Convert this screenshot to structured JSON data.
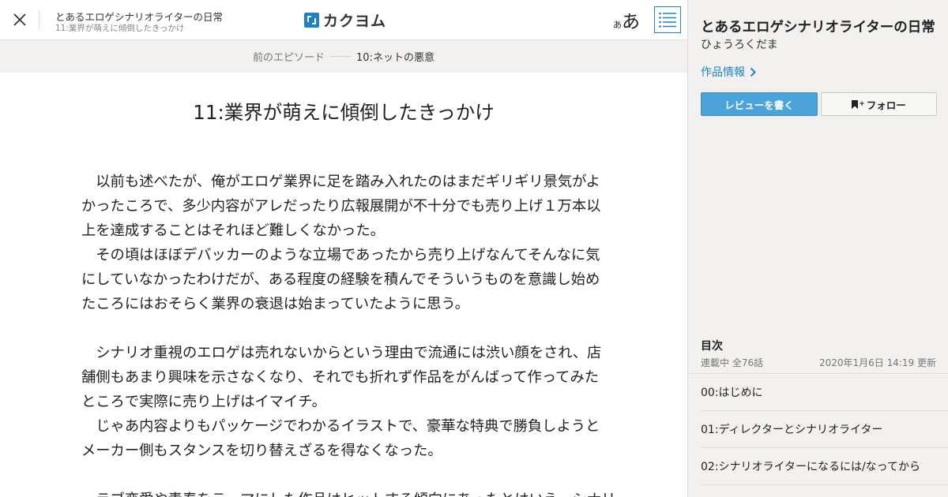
{
  "header": {
    "work_title": "とあるエロゲシナリオライターの日常",
    "episode_title": "11:業界が萌えに傾倒したきっかけ",
    "logo_text": "カクヨム",
    "font_small": "あ",
    "font_large": "あ",
    "icons": {
      "close": "close-icon",
      "logo": "kakuyomu-logo-icon",
      "toc": "list-icon"
    },
    "accent_color": "#1d82c4"
  },
  "episode_nav": {
    "prev_label": "前のエピソード",
    "prev_title": "10:ネットの悪意"
  },
  "episode": {
    "title": "11:業界が萌えに傾倒したきっかけ",
    "lines": [
      "　以前も述べたが、俺がエロゲ業界に足を踏み入れたのはまだギリギリ景気がよ",
      "かったころで、多少内容がアレだったり広報展開が不十分でも売り上げ１万本以",
      "上を達成することはそれほど難しくなかった。",
      "　その頃はほぼデバッカーのような立場であったから売り上げなんてそんなに気",
      "にしていなかったわけだが、ある程度の経験を積んでそういうものを意識し始め",
      "たころにはおそらく業界の衰退は始まっていたように思う。",
      "",
      "　シナリオ重視のエロゲは売れないからという理由で流通には渋い顔をされ、店",
      "舗側もあまり興味を示さなくなり、それでも折れず作品をがんばって作ってみた",
      "ところで実際に売り上げはイマイチ。",
      "　じゃあ内容よりもパッケージでわかるイラストで、豪華な特典で勝負しようと",
      "メーカー側もスタンスを切り替えざるを得なくなった。",
      "",
      "　ラブ恋愛や青春をテーマにした作品はヒットする傾向にあったとはいえ、シナリ"
    ]
  },
  "sidebar": {
    "work_title": "とあるエロゲシナリオライターの日常",
    "author": "ひょうろくだま",
    "info_link": "作品情報",
    "review_button": "レビューを書く",
    "follow_button": "フォロー",
    "icons": {
      "info_chevron": "chevron-right-icon",
      "follow": "bookmark-icon"
    },
    "review_button_color": "#4ba3d9"
  },
  "toc": {
    "heading": "目次",
    "status": "連載中 全76話",
    "updated": "2020年1月6日 14:19 更新",
    "items": [
      "00:はじめに",
      "01:ディレクターとシナリオライター",
      "02:シナリオライターになるには/なってから"
    ]
  }
}
